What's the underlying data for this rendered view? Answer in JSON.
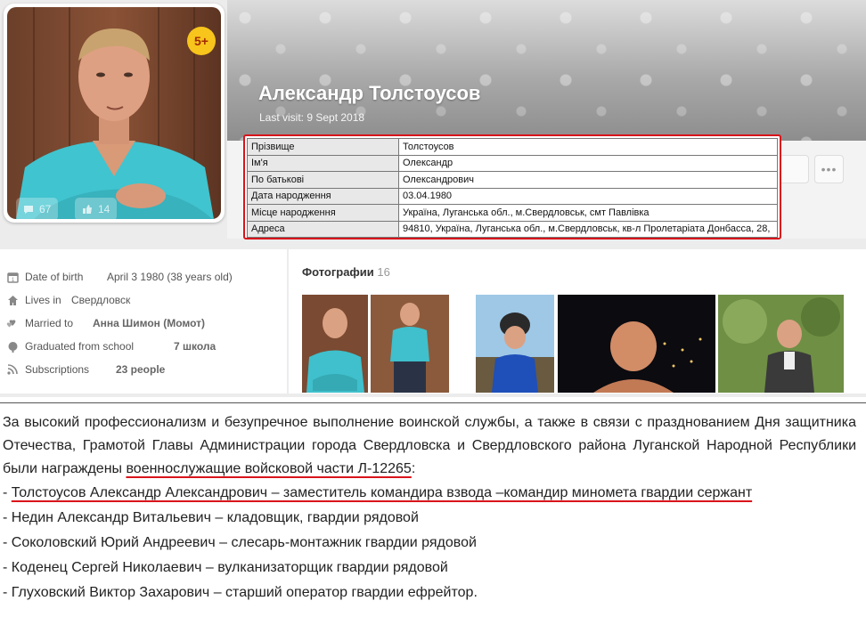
{
  "profile": {
    "name": "Александр Толстоусов",
    "last_visit": "Last visit: 9 Sept 2018",
    "badge": "5+",
    "comments_count": "67",
    "likes_count": "14",
    "more_label": "•••"
  },
  "personal_table": [
    {
      "key": "Прізвище",
      "value": "Толстоусов"
    },
    {
      "key": "Ім'я",
      "value": "Олександр"
    },
    {
      "key": "По батькові",
      "value": "Олександрович"
    },
    {
      "key": "Дата народження",
      "value": "03.04.1980"
    },
    {
      "key": "Місце народження",
      "value": "Україна, Луганська обл., м.Свердловськ, смт Павлівка"
    },
    {
      "key": "Адреса",
      "value": "94810, Україна, Луганська обл., м.Свердловськ, кв-л Пролетаріата Донбасса, 28,"
    }
  ],
  "info": {
    "birth_label": "Date of birth",
    "birth_value": "April 3 1980 (38 years old)",
    "lives_label": "Lives in",
    "lives_value": "Свердловск",
    "married_label": "Married to",
    "married_value": "Анна Шимон (Момот)",
    "school_label": "Graduated from school",
    "school_value": "7 школа",
    "subs_label": "Subscriptions",
    "subs_value": "23 people"
  },
  "photos": {
    "title": "Фотографии",
    "count": "16"
  },
  "article": {
    "intro_plain": "За высокий профессионализм и безупречное выполнение воинской службы, а также в связи с празднованием Дня защитника Отечества, Грамотой  Главы  Администрации города Свердловска и Свердловского района Луганской Народной Республики были награждены ",
    "intro_underlined": "военнослужащие войсковой части Л-12265",
    "intro_end": ":",
    "line1_prefix": "- ",
    "line1_underlined": "Толстоусов Александр Александрович – заместитель командира взвода –командир миномета гвардии сержант",
    "line2": "- Недин Александр  Витальевич – кладовщик, гвардии рядовой",
    "line3": "- Соколовский Юрий Андреевич – слесарь-монтажник гвардии рядовой",
    "line4": "- Коденец Сергей Николаевич – вулканизаторщик гвардии рядовой",
    "line5": "- Глуховский Виктор Захарович – старший оператор гвардии ефрейтор."
  },
  "colors": {
    "highlight_red": "#d9141b",
    "badge_yellow": "#f7c51b"
  }
}
